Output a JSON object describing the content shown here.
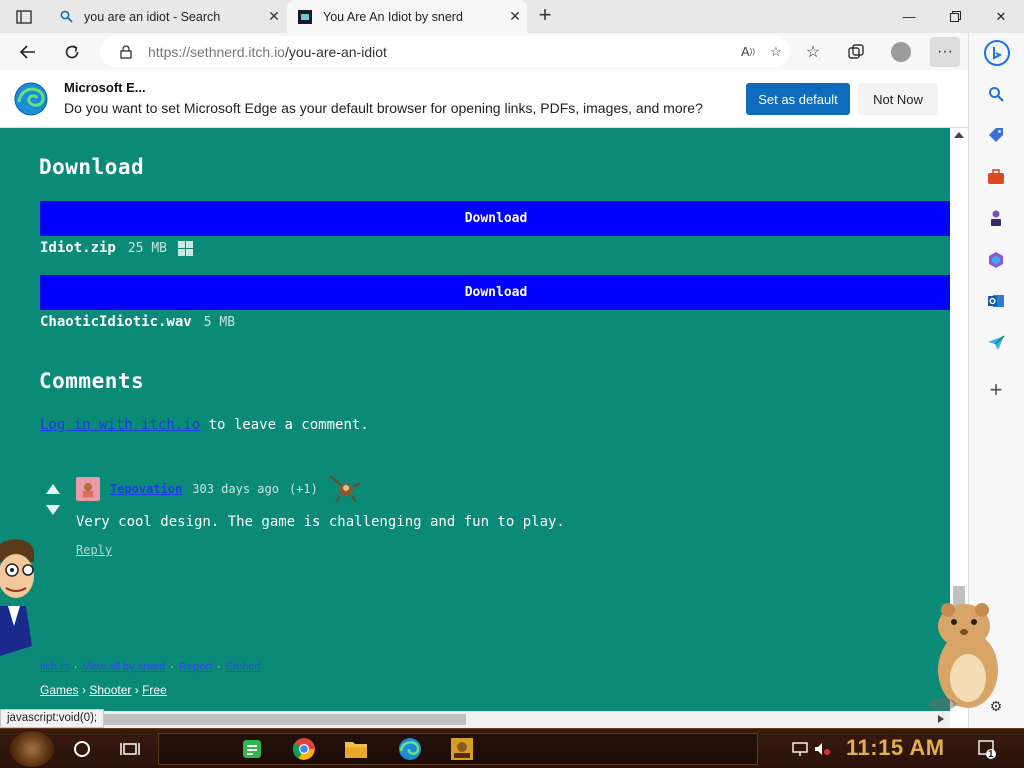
{
  "browser": {
    "tabs": [
      {
        "title": "you are an idiot - Search",
        "icon": "search-icon"
      },
      {
        "title": "You Are An Idiot by snerd",
        "icon": "itch-favicon"
      }
    ],
    "url_host": "https://sethnerd.itch.io",
    "url_path": "/you-are-an-idiot"
  },
  "infobar": {
    "title": "Microsoft E...",
    "message": "Do you want to set Microsoft Edge as your default browser for opening links, PDFs, images, and more?",
    "primary_label": "Set as default",
    "secondary_label": "Not Now"
  },
  "page": {
    "download_heading": "Download",
    "downloads": [
      {
        "button_label": "Download",
        "file_name": "Idiot.zip",
        "file_size": "25 MB",
        "platform_icon": "windows-icon"
      },
      {
        "button_label": "Download",
        "file_name": "ChaoticIdiotic.wav",
        "file_size": "5 MB"
      }
    ],
    "comments_heading": "Comments",
    "login_link": "Log in with itch.io",
    "login_suffix": " to leave a comment.",
    "comment": {
      "author": "Tepovation",
      "age": "303 days ago",
      "score": "(+1)",
      "body": "Very cool design. The game is challenging and fun to play.",
      "reply": "Reply"
    },
    "footer": {
      "links": [
        "itch.io",
        "View all by snerd",
        "Report",
        "Embed"
      ],
      "separator": "·",
      "crumbs": [
        "Games",
        "Shooter",
        "Free"
      ],
      "crumb_sep": "›"
    }
  },
  "status_tip": "javascript:void(0);",
  "taskbar": {
    "clock": "11:15 AM",
    "notification_count": "1"
  },
  "colors": {
    "page_bg": "#0c8a78",
    "download_button": "#0000ff",
    "edge_blue": "#0f6cbd"
  }
}
